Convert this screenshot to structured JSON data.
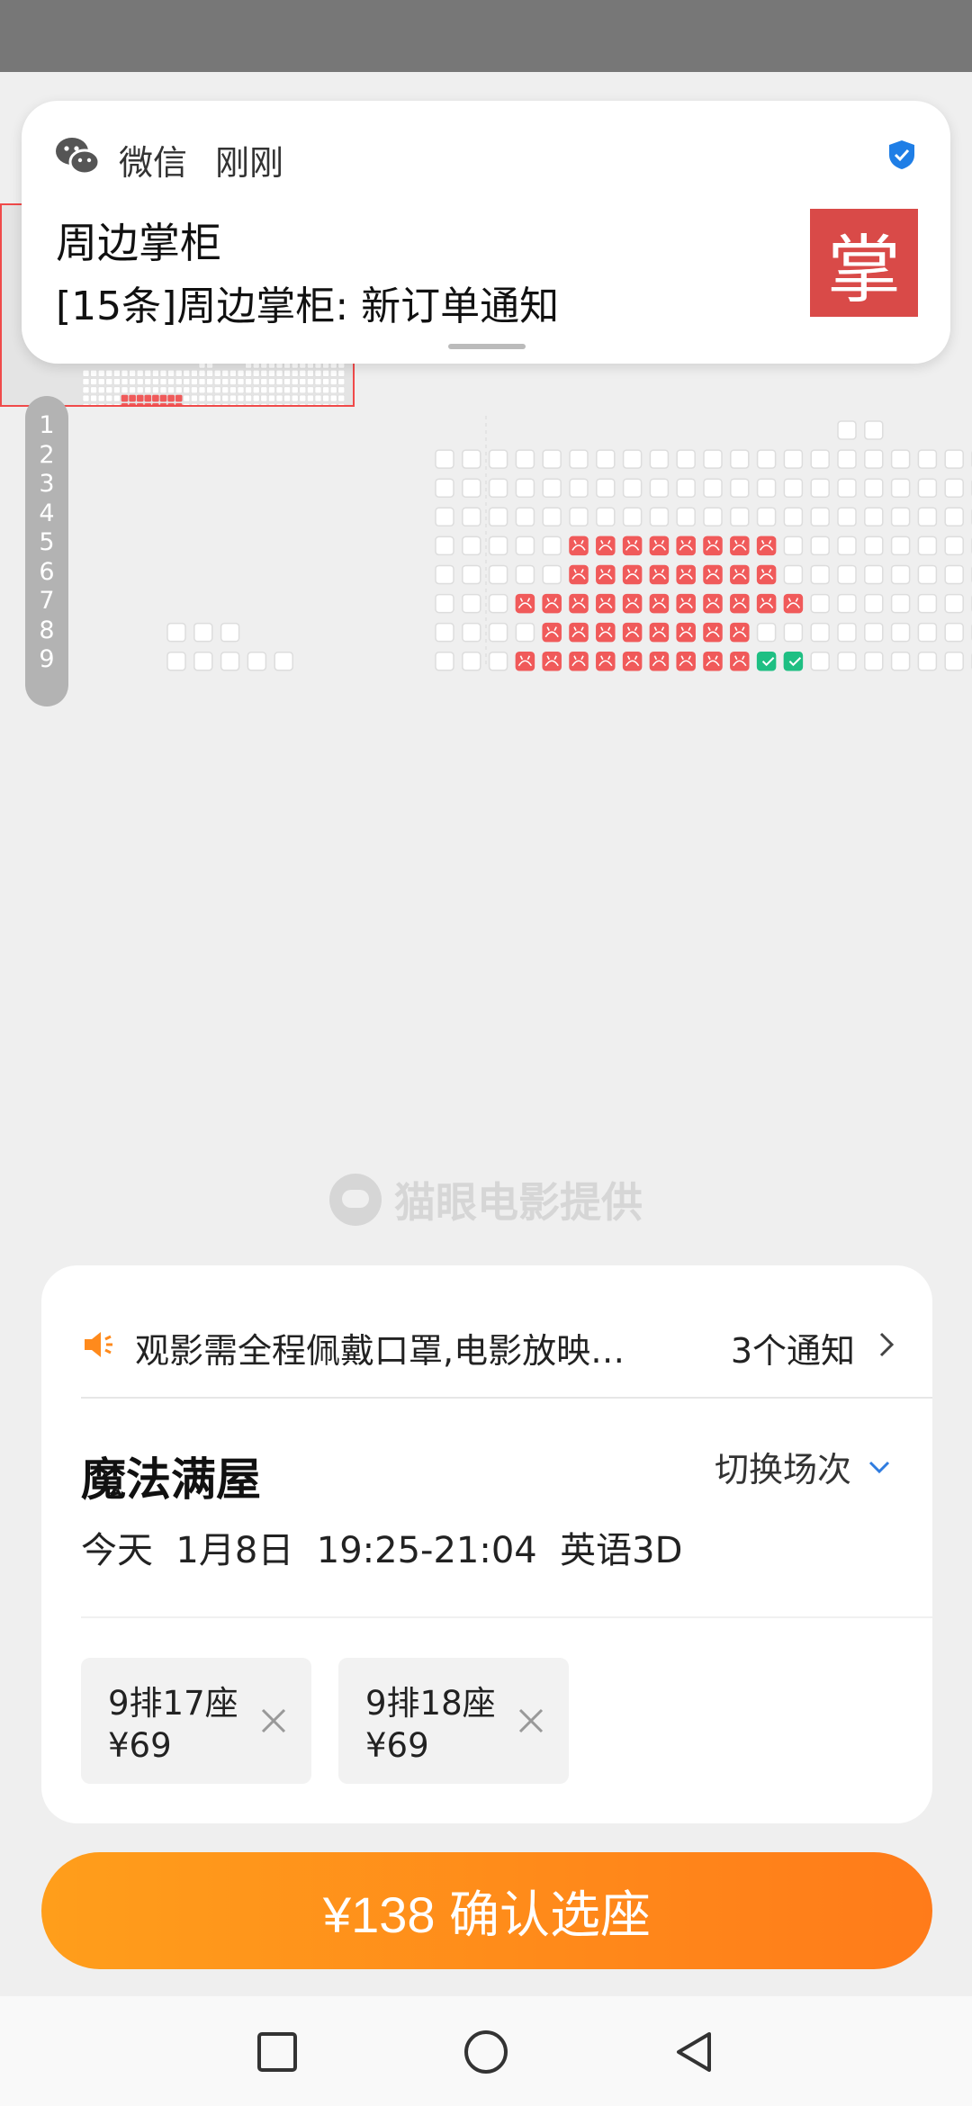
{
  "notification": {
    "app": "微信",
    "time": "刚刚",
    "title": "周边掌柜",
    "body": "[15条]周边掌柜: 新订单通知",
    "thumb_char": "掌"
  },
  "row_numbers": [
    "1",
    "2",
    "3",
    "4",
    "5",
    "6",
    "7",
    "8",
    "9"
  ],
  "watermark": "猫眼电影提供",
  "notice": {
    "text": "观影需全程佩戴口罩,电影放映…",
    "count": "3个通知"
  },
  "movie": {
    "title": "魔法满屋",
    "switch_label": "切换场次",
    "showtime": "今天  1月8日  19:25-21:04  英语3D"
  },
  "selected_seats": [
    {
      "seat": "9排17座",
      "price": "¥69"
    },
    {
      "seat": "9排18座",
      "price": "¥69"
    }
  ],
  "confirm_label": "¥138 确认选座",
  "colors": {
    "sold": "#f05a5a",
    "selected": "#1fbf83",
    "available": "#ffffff",
    "accent": "#ff8a1c"
  },
  "seat_grid": {
    "rows": [
      ".........................AA....AAAAAAAAAAAAA",
      "..........AAAAAAAAAAAAAAAAAAAAAAAAAAAAAAAAAA",
      "..........AAAAAAAAAAAAAAAAAAAAAAAAAAAAAAAAAA",
      "..........AAAAAAAAAAAAAAAAAAAAAAAAAAAAAAAAAA",
      "..........AAAAASSSSSSSSAAAAAAAAAAAAAAAAAAAAA",
      "..........AAAAASSSSSSSSAAAAAAAAAAAAAAAAAAAAA",
      "..........AAASSSSSSSSSSSAAAAAAAAAAAAAAAAAAAA",
      "AAA.......AAAASSSSSSSSAAAAAAAAAAAAAAAAAAAAAA",
      "AAAAA.....AAASSSSSSSSSGGAAAAAAAAAAAAAAAAAAAA"
    ],
    "legend": {
      "A": "available",
      "S": "sold",
      "G": "selected"
    }
  }
}
